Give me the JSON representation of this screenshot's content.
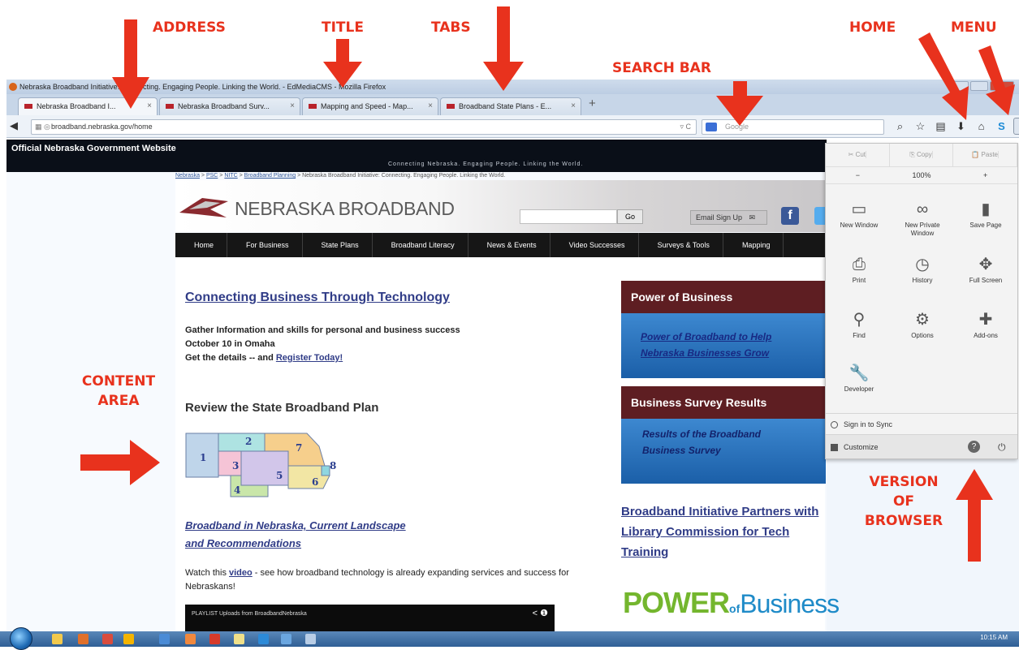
{
  "annotations": {
    "address": "ADDRESS",
    "title": "TITLE",
    "tabs": "TABS",
    "search_bar": "SEARCH BAR",
    "home": "HOME",
    "menu": "MENU",
    "content_area": "CONTENT\nAREA",
    "version": "VERSION\nOF\nBROWSER"
  },
  "window": {
    "title": "Nebraska Broadband Initiative: Connecting. Engaging People. Linking the World. - EdMediaCMS - Mozilla Firefox"
  },
  "tabs": [
    {
      "label": "Nebraska Broadband I...",
      "active": true
    },
    {
      "label": "Nebraska Broadband Surv...",
      "active": false
    },
    {
      "label": "Mapping and Speed - Map...",
      "active": false
    },
    {
      "label": "Broadband State Plans - E...",
      "active": false
    }
  ],
  "tab_close": "×",
  "new_tab": "+",
  "navbar": {
    "url": "broadband.nebraska.gov/home",
    "reload": "▿ C",
    "search_placeholder": "Google",
    "icons": [
      "search-icon",
      "bookmark-star-icon",
      "bookmarks-list-icon",
      "download-icon",
      "home-icon",
      "skype-icon",
      "menu-icon"
    ]
  },
  "site": {
    "gov_label": "Official Nebraska Government Website",
    "tagline": "Connecting Nebraska. Engaging People. Linking the World.",
    "breadcrumb": [
      "Nebraska",
      "PSC",
      "NITC",
      "Broadband Planning",
      "Nebraska Broadband Initiative: Connecting. Engaging People. Linking the World."
    ],
    "logo_text": "NEBRASKA BROADBAND",
    "search_button": "Go",
    "email_button": "Email Sign Up",
    "facebook": "f",
    "nav": [
      "Home",
      "For Business",
      "State Plans",
      "Broadband Literacy",
      "News & Events",
      "Video Successes",
      "Surveys & Tools",
      "Mapping"
    ],
    "headline": "Connecting Business Through Technology",
    "event_line1": "Gather Information and skills for personal and business success",
    "event_line2": "October 10 in Omaha",
    "event_line3": "Get the details -- and ",
    "register_link": "Register Today!",
    "plan_heading": "Review the State Broadband Plan",
    "map_regions": [
      "1",
      "2",
      "3",
      "4",
      "5",
      "6",
      "7",
      "8"
    ],
    "map_link_line1": "Broadband in Nebraska, Current Landscape",
    "map_link_line2": "and Recommendations",
    "watch_prefix": "Watch this ",
    "video_link": "video",
    "watch_suffix": " - see how broadband technology is already expanding services and success for Nebraskans!",
    "video_bar": "PLAYLIST   Uploads from BroadbandNebraska",
    "video_share": "< ❶",
    "promo1_head": "Power of Business",
    "promo1_line1": "Power of Broadband to Help",
    "promo1_line2": "Nebraska Businesses Grow",
    "promo2_head": "Business Survey Results",
    "promo2_line1": "Results of the Broadband",
    "promo2_line2": "Business Survey",
    "partners": "Broadband Initiative Partners with Library Commission for Tech Training",
    "power_logo_main": "POWER",
    "power_logo_of": "of",
    "power_logo_business": "Business"
  },
  "menu_panel": {
    "cut": "Cut",
    "copy": "Copy",
    "paste": "Paste",
    "zoom_out": "−",
    "zoom_level": "100%",
    "zoom_in": "+",
    "items": [
      {
        "label": "New Window",
        "icon": "window-icon"
      },
      {
        "label": "New Private Window",
        "icon": "mask-icon"
      },
      {
        "label": "Save Page",
        "icon": "page-icon"
      },
      {
        "label": "Print",
        "icon": "printer-icon"
      },
      {
        "label": "History",
        "icon": "clock-icon"
      },
      {
        "label": "Full Screen",
        "icon": "fullscreen-icon"
      },
      {
        "label": "Find",
        "icon": "magnifier-icon"
      },
      {
        "label": "Options",
        "icon": "gear-icon"
      },
      {
        "label": "Add-ons",
        "icon": "puzzle-icon"
      },
      {
        "label": "Developer",
        "icon": "wrench-icon"
      }
    ],
    "sync": "Sign in to Sync",
    "customize": "Customize",
    "help": "?"
  },
  "taskbar": {
    "clock": "10:15 AM"
  }
}
